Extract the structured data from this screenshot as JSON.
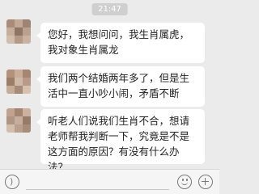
{
  "timestamp": "21:47",
  "messages": [
    {
      "text": "您好，我想问问，我生肖属虎，我对象生肖属龙"
    },
    {
      "text": "我们两个结婚两年多了，但是生活中一直小吵小闹，矛盾不断"
    },
    {
      "text": "听老人们说我们生肖不合，想请老师帮我判断一下，究竟是不是这方面的原因？有没有什么办法？"
    }
  ],
  "input_bar": {
    "icons": [
      "voice-icon",
      "emoji-icon",
      "plus-icon"
    ],
    "placeholder": ""
  }
}
